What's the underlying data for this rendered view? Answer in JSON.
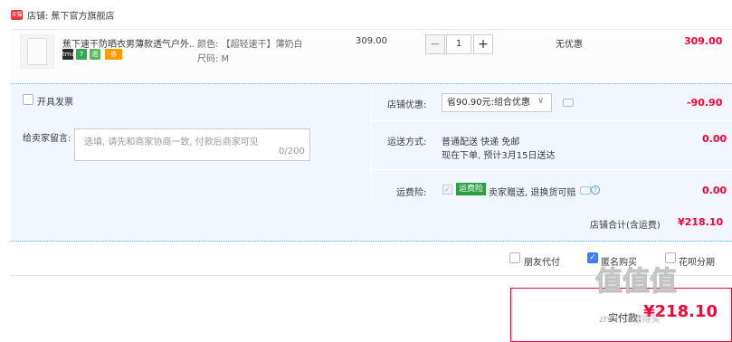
{
  "shop": {
    "badge": "天猫",
    "label": "店铺: 蕉下官方旗舰店"
  },
  "item": {
    "title": "蕉下速干防晒衣男薄款透气户外...",
    "tags": [
      {
        "text": "tmall",
        "color": "#2b2b2b"
      },
      {
        "text": "7",
        "color": "#33a852"
      },
      {
        "text": "退",
        "color": "#5cb85c"
      },
      {
        "text": "券",
        "color": "#ff9900"
      }
    ],
    "sku_color": "颜色: 【超轻速干】薄奶白",
    "sku_size": "尺码: M",
    "price": "309.00",
    "minus": "−",
    "quantity": "1",
    "plus": "+",
    "discount": "无优惠",
    "subtotal": "309.00"
  },
  "invoice": {
    "label": "开具发票"
  },
  "message": {
    "label": "给卖家留言:",
    "placeholder": "选填, 请先和商家协商一致, 付款后商家可见",
    "count": "0/200"
  },
  "shop_discount": {
    "label": "店铺优惠:",
    "selected": "省90.90元:组合优惠",
    "amount": "-90.90"
  },
  "shipping": {
    "label": "运送方式:",
    "method": "普通配送 快递 免邮",
    "estimate": "现在下单, 预计3月15日送达",
    "amount": "0.00"
  },
  "insurance": {
    "label": "运费险:",
    "badge": "运费险",
    "text": "卖家赠送, 退换货可赔",
    "amount": "0.00"
  },
  "shop_total": {
    "label": "店铺合计(含运费)",
    "value": "¥218.10"
  },
  "bottom_options": {
    "friend_pay": "朋友代付",
    "anonymous": "匿名购买",
    "installment": "花呗分期"
  },
  "payment": {
    "label": "实付款:",
    "value": "¥218.10"
  },
  "watermark": {
    "glyphs": "值值值",
    "sub": "zhi.什么值得买"
  },
  "colors": {
    "accent_red": "#ff0036",
    "panel_blue": "#f2f7ff",
    "check_blue": "#3d7eff",
    "insurance_green": "#2f9e43"
  }
}
